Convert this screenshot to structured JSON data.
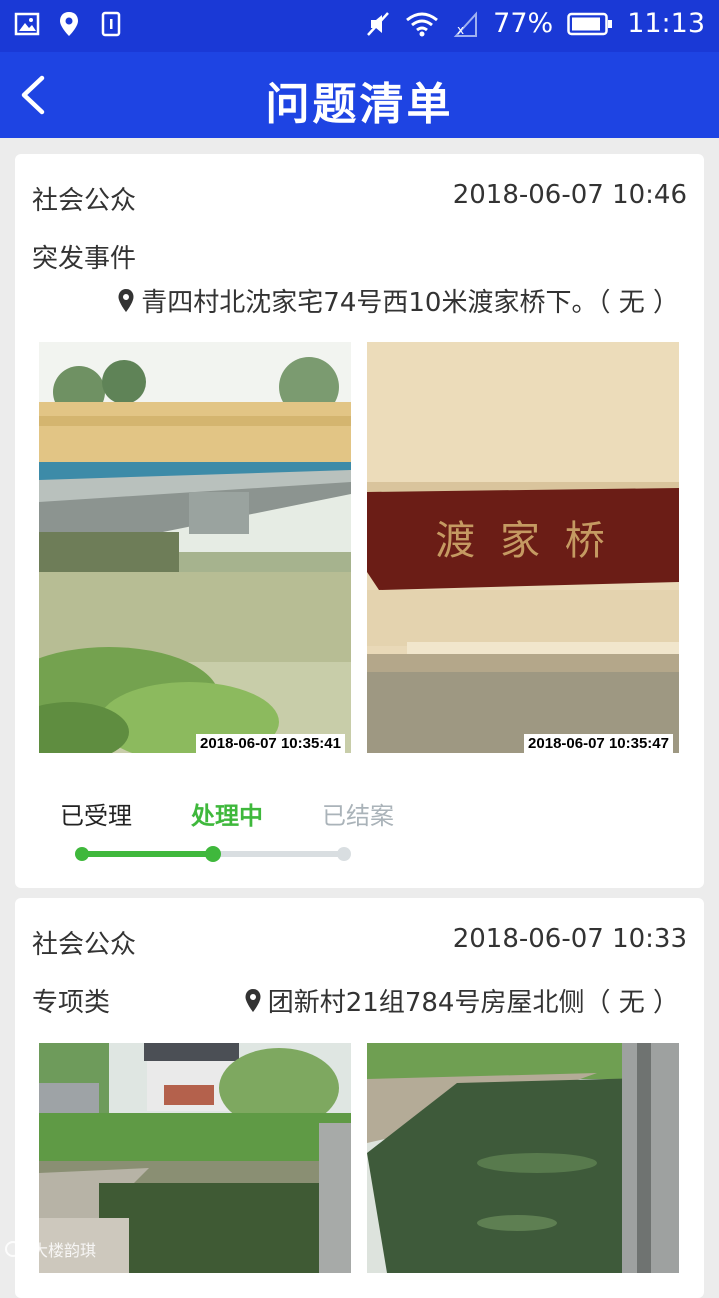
{
  "status_bar": {
    "battery": "77%",
    "time": "11:13"
  },
  "header": {
    "title": "问题清单"
  },
  "issues": [
    {
      "source": "社会公众",
      "time": "2018-06-07 10:46",
      "category": "突发事件",
      "location": "青四村北沈家宅74号西10米渡家桥下。（ 无 ）",
      "photos": [
        {
          "stamp": "2018-06-07 10:35:41"
        },
        {
          "stamp": "2018-06-07 10:35:47",
          "sign_text": "渡 家 桥"
        }
      ],
      "progress": {
        "steps": [
          "已受理",
          "处理中",
          "已结案"
        ],
        "current_step": 2
      }
    },
    {
      "source": "社会公众",
      "time": "2018-06-07 10:33",
      "category": "专项类",
      "location": "团新村21组784号房屋北侧（ 无 ）"
    }
  ],
  "watermark": "大楼韵琪",
  "colors": {
    "header": "#1e44e3",
    "status_bar": "#1a39d6",
    "step_active": "#3fb83c",
    "step_inactive": "#d9dee1"
  }
}
